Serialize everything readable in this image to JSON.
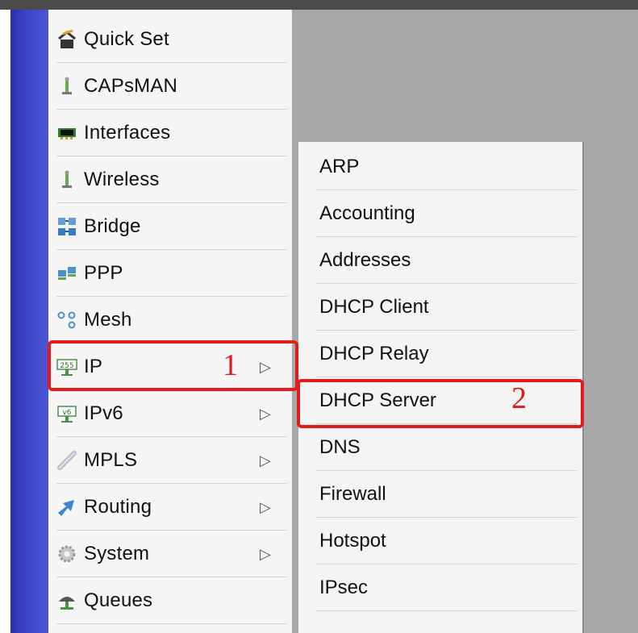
{
  "main_menu": {
    "items": [
      {
        "label": "Quick Set",
        "icon": "quick-set-icon",
        "arrow": ""
      },
      {
        "label": "CAPsMAN",
        "icon": "capsman-antenna-icon",
        "arrow": ""
      },
      {
        "label": "Interfaces",
        "icon": "interfaces-card-icon",
        "arrow": ""
      },
      {
        "label": "Wireless",
        "icon": "wireless-antenna-icon",
        "arrow": ""
      },
      {
        "label": "Bridge",
        "icon": "bridge-icon",
        "arrow": ""
      },
      {
        "label": "PPP",
        "icon": "ppp-icon",
        "arrow": ""
      },
      {
        "label": "Mesh",
        "icon": "mesh-icon",
        "arrow": ""
      },
      {
        "label": "IP",
        "icon": "ip-icon",
        "arrow": "▷",
        "annotation": "1"
      },
      {
        "label": "IPv6",
        "icon": "ipv6-icon",
        "arrow": "▷"
      },
      {
        "label": "MPLS",
        "icon": "mpls-icon",
        "arrow": "▷"
      },
      {
        "label": "Routing",
        "icon": "routing-icon",
        "arrow": "▷"
      },
      {
        "label": "System",
        "icon": "system-gear-icon",
        "arrow": "▷"
      },
      {
        "label": "Queues",
        "icon": "queues-icon",
        "arrow": ""
      }
    ]
  },
  "ip_submenu": {
    "items": [
      {
        "label": "ARP"
      },
      {
        "label": "Accounting"
      },
      {
        "label": "Addresses"
      },
      {
        "label": "DHCP Client"
      },
      {
        "label": "DHCP Relay"
      },
      {
        "label": "DHCP Server",
        "annotation": "2"
      },
      {
        "label": "DNS"
      },
      {
        "label": "Firewall"
      },
      {
        "label": "Hotspot"
      },
      {
        "label": "IPsec"
      }
    ]
  },
  "colors": {
    "highlight_border": "#e51b1b",
    "annotation_number": "#d81e1e",
    "left_bar": "#3e47c8",
    "desktop": "#a8a8ab"
  }
}
